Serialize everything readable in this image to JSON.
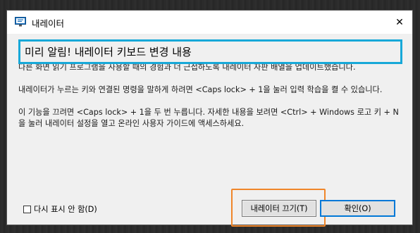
{
  "window": {
    "title": "내레이터",
    "close_symbol": "✕"
  },
  "heading": "미리 알림! 내레이터 키보드 변경 내용",
  "paragraphs": [
    "다른 화면 읽기 프로그램을 사용할 때의 경험과 더 근접하도록 내레이터 자판 배열을 업데이트했습니다.",
    "내레이터가 누르는 키와 연결된 명령을 말하게 하려면 <Caps lock> + 1을 눌러 입력 학습을 켤 수 있습니다.",
    "이 기능을 끄려면 <Caps lock> + 1을 두 번 누릅니다. 자세한 내용을 보려면 <Ctrl> + Windows 로고 키 + N을 눌러 내레이터 설정을 열고 온라인 사용자 가이드에 액세스하세요."
  ],
  "footer": {
    "dont_show_label": "다시 표시 안 함(D)",
    "dont_show_checked": false,
    "turn_off_label": "내레이터 끄기(T)",
    "ok_label": "확인(O)"
  },
  "colors": {
    "highlight_heading": "#17a8d8",
    "highlight_button": "#f0862a",
    "default_button_border": "#0078d7"
  }
}
